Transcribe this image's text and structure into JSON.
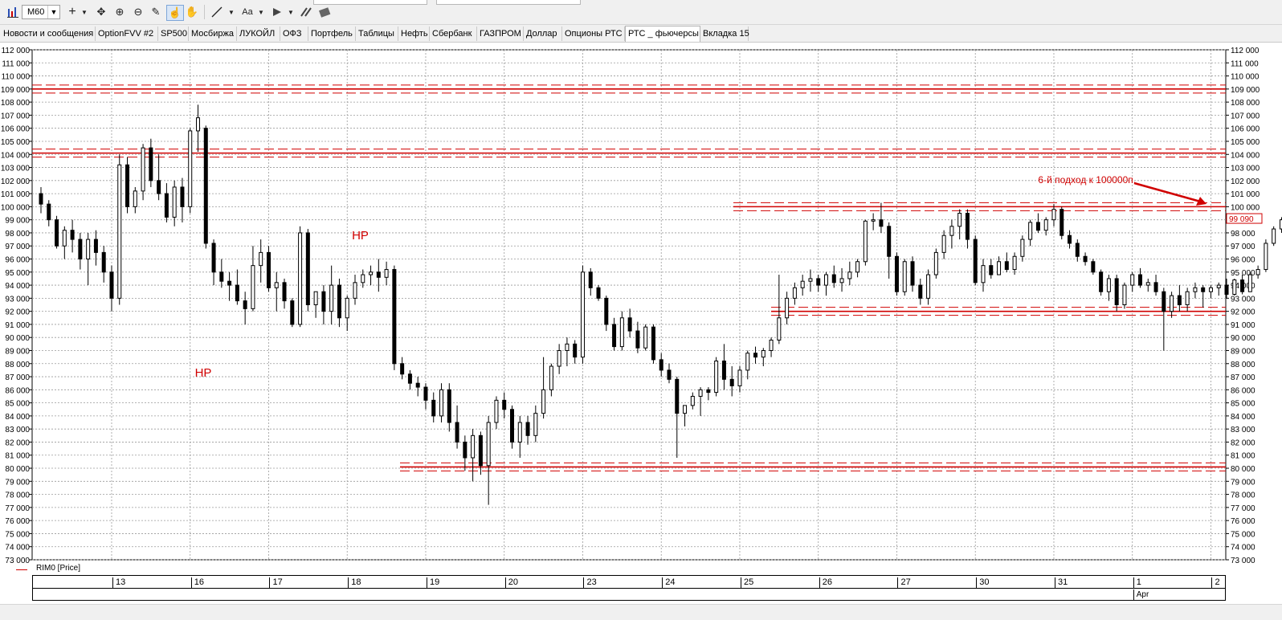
{
  "toolbar": {
    "period": "M60",
    "text_tool_label": "Aa"
  },
  "tabs": [
    "Новости и сообщения",
    "OptionFVV #2",
    "SP500",
    "Мосбиржа",
    "ЛУКОЙЛ",
    "ОФЗ",
    "Портфель",
    "Таблицы",
    "Нефть",
    "Сбербанк",
    "ГАЗПРОМ",
    "Доллар",
    "Опционы РТС",
    "РТС _ фьючерсы",
    "Вкладка 15"
  ],
  "active_tab_index": 13,
  "legend": {
    "series_label": "RIM0 [Price]"
  },
  "colors": {
    "support_lines": "#d00000",
    "annotation": "#d00000",
    "candles": "#000000",
    "price_tag": "#d00000"
  },
  "price_tag": "99 090",
  "time_axis": {
    "days": [
      "13",
      "16",
      "17",
      "18",
      "19",
      "20",
      "23",
      "24",
      "25",
      "26",
      "27",
      "30",
      "31",
      "1",
      "2"
    ],
    "month_label": "Apr"
  },
  "chart_data": {
    "type": "candlestick",
    "symbol": "RIM0",
    "timeframe": "M60",
    "ylim": [
      73000,
      112000
    ],
    "y_ticks": [
      "73 000",
      "74 000",
      "75 000",
      "76 000",
      "77 000",
      "78 000",
      "79 000",
      "80 000",
      "81 000",
      "82 000",
      "83 000",
      "84 000",
      "85 000",
      "86 000",
      "87 000",
      "88 000",
      "89 000",
      "90 000",
      "91 000",
      "92 000",
      "93 000",
      "94 000",
      "95 000",
      "96 000",
      "97 000",
      "98 000",
      "99 000",
      "100 000",
      "101 000",
      "102 000",
      "103 000",
      "104 000",
      "105 000",
      "106 000",
      "107 000",
      "108 000",
      "109 000",
      "110 000",
      "111 000",
      "112 000"
    ],
    "grid": true,
    "levels": [
      109000,
      104100,
      100000,
      92000,
      80100
    ],
    "annotations": [
      {
        "text": "НР",
        "x": 19.8,
        "y": 97500
      },
      {
        "text": "НР",
        "x": 9.8,
        "y": 87000
      },
      {
        "text": "6-й подход к 100000п.",
        "x": 63.5,
        "y": 101800
      }
    ],
    "x_start_day": "13 Mar",
    "x_day_starts": [
      5,
      10,
      15,
      20,
      25,
      30,
      35,
      40,
      45,
      50,
      55,
      60,
      65,
      70,
      75
    ],
    "candles": [
      [
        101000,
        101500,
        99500,
        100200
      ],
      [
        100200,
        100500,
        98500,
        99000
      ],
      [
        99000,
        99300,
        96800,
        97000
      ],
      [
        97000,
        98500,
        96000,
        98200
      ],
      [
        98200,
        99000,
        96500,
        97500
      ],
      [
        97500,
        98000,
        95200,
        96000
      ],
      [
        96000,
        98000,
        94000,
        97500
      ],
      [
        97500,
        98200,
        95500,
        96500
      ],
      [
        96500,
        97000,
        94200,
        95000
      ],
      [
        95000,
        95500,
        92000,
        93000
      ],
      [
        93000,
        104000,
        92500,
        103200
      ],
      [
        103200,
        103800,
        99500,
        100000
      ],
      [
        100000,
        101500,
        99500,
        101200
      ],
      [
        101200,
        104800,
        100500,
        104500
      ],
      [
        104500,
        105200,
        101500,
        102000
      ],
      [
        102000,
        104000,
        100500,
        101000
      ],
      [
        101000,
        101800,
        98800,
        99200
      ],
      [
        99200,
        102000,
        98500,
        101500
      ],
      [
        101500,
        102200,
        98800,
        100000
      ],
      [
        100000,
        106000,
        99500,
        105800
      ],
      [
        105800,
        107800,
        104200,
        106800
      ],
      [
        106000,
        106200,
        96800,
        97200
      ],
      [
        97200,
        97500,
        94000,
        95000
      ],
      [
        95000,
        96000,
        93800,
        94300
      ],
      [
        94300,
        95000,
        92800,
        94000
      ],
      [
        94000,
        95200,
        92500,
        92800
      ],
      [
        92800,
        93500,
        91000,
        92200
      ],
      [
        92200,
        97000,
        92000,
        95500
      ],
      [
        95500,
        97500,
        94200,
        96500
      ],
      [
        96500,
        97000,
        93500,
        93800
      ],
      [
        93800,
        95000,
        92000,
        94200
      ],
      [
        94200,
        94500,
        92200,
        92800
      ],
      [
        92800,
        93000,
        90800,
        91000
      ],
      [
        91000,
        98500,
        90800,
        98000
      ],
      [
        98000,
        98300,
        92000,
        92500
      ],
      [
        92500,
        93500,
        91500,
        93500
      ],
      [
        93500,
        94000,
        91000,
        92000
      ],
      [
        92000,
        95500,
        91000,
        94000
      ],
      [
        94000,
        94500,
        90800,
        91500
      ],
      [
        91500,
        93200,
        90500,
        93000
      ],
      [
        93000,
        94800,
        92500,
        94200
      ],
      [
        94200,
        95200,
        93800,
        94800
      ],
      [
        94800,
        95500,
        94000,
        95000
      ],
      [
        95000,
        96000,
        93500,
        94600
      ],
      [
        94600,
        95800,
        94000,
        95200
      ],
      [
        95200,
        95500,
        87500,
        88000
      ],
      [
        88000,
        88500,
        86800,
        87200
      ],
      [
        87200,
        87500,
        86000,
        86500
      ],
      [
        86500,
        87000,
        85500,
        86200
      ],
      [
        86200,
        86500,
        84500,
        85200
      ],
      [
        85200,
        85800,
        83500,
        84000
      ],
      [
        84000,
        86500,
        83500,
        86000
      ],
      [
        86000,
        86500,
        82800,
        83500
      ],
      [
        83500,
        84800,
        81500,
        82000
      ],
      [
        82000,
        82500,
        79800,
        80800
      ],
      [
        80800,
        83000,
        79000,
        82500
      ],
      [
        82500,
        82800,
        79500,
        80200
      ],
      [
        80200,
        84000,
        77200,
        83500
      ],
      [
        83500,
        85500,
        83000,
        85200
      ],
      [
        85200,
        85800,
        83800,
        84500
      ],
      [
        84500,
        84800,
        81500,
        82000
      ],
      [
        82000,
        84000,
        80800,
        83500
      ],
      [
        83500,
        84000,
        81800,
        82500
      ],
      [
        82500,
        84800,
        82000,
        84200
      ],
      [
        84200,
        88500,
        83800,
        86000
      ],
      [
        86000,
        88000,
        85500,
        87800
      ],
      [
        87800,
        89500,
        87200,
        89000
      ],
      [
        89000,
        90000,
        87800,
        89500
      ],
      [
        89500,
        89800,
        88000,
        88500
      ],
      [
        88500,
        95500,
        88000,
        95000
      ],
      [
        95000,
        95300,
        93200,
        93800
      ],
      [
        93800,
        94000,
        92800,
        93000
      ],
      [
        93000,
        93200,
        90500,
        91000
      ],
      [
        91000,
        91500,
        89000,
        89300
      ],
      [
        89300,
        92000,
        89000,
        91500
      ],
      [
        91500,
        92200,
        90000,
        90500
      ],
      [
        90500,
        91200,
        88800,
        89200
      ],
      [
        89200,
        91000,
        89000,
        90800
      ],
      [
        90800,
        91000,
        88000,
        88300
      ],
      [
        88300,
        88800,
        87000,
        87500
      ],
      [
        87500,
        88000,
        86500,
        86800
      ],
      [
        86800,
        87000,
        80800,
        84200
      ],
      [
        84200,
        84800,
        83200,
        84800
      ],
      [
        84800,
        85800,
        84500,
        85500
      ],
      [
        85500,
        86200,
        84000,
        86000
      ],
      [
        86000,
        86200,
        85200,
        85800
      ],
      [
        85800,
        88500,
        85500,
        88200
      ],
      [
        88200,
        89500,
        86000,
        86800
      ],
      [
        86800,
        87800,
        85500,
        86300
      ],
      [
        86300,
        87800,
        85800,
        87500
      ],
      [
        87500,
        89000,
        86800,
        88800
      ],
      [
        88800,
        89300,
        88000,
        88500
      ],
      [
        88500,
        89200,
        87800,
        89000
      ],
      [
        89000,
        90000,
        88500,
        89800
      ],
      [
        89800,
        94800,
        89500,
        91500
      ],
      [
        91500,
        93500,
        91000,
        93000
      ],
      [
        93000,
        94200,
        92500,
        93800
      ],
      [
        93800,
        94800,
        93200,
        94300
      ],
      [
        94300,
        95200,
        93500,
        94500
      ],
      [
        94500,
        94800,
        93500,
        94000
      ],
      [
        94000,
        95000,
        93200,
        94800
      ],
      [
        94800,
        95500,
        93800,
        94200
      ],
      [
        94200,
        95300,
        93500,
        94500
      ],
      [
        94500,
        95800,
        94000,
        95000
      ],
      [
        95000,
        96000,
        94600,
        95800
      ],
      [
        95800,
        99000,
        95500,
        98900
      ],
      [
        98900,
        99500,
        98200,
        99000
      ],
      [
        99000,
        100300,
        98000,
        98500
      ],
      [
        98500,
        98800,
        94500,
        96200
      ],
      [
        96200,
        96500,
        93200,
        93500
      ],
      [
        93500,
        96000,
        93200,
        95800
      ],
      [
        95800,
        96200,
        93500,
        94000
      ],
      [
        94000,
        94500,
        92500,
        93000
      ],
      [
        93000,
        95200,
        92500,
        94800
      ],
      [
        94800,
        96800,
        94500,
        96500
      ],
      [
        96500,
        98200,
        96000,
        97800
      ],
      [
        97800,
        99000,
        96800,
        98500
      ],
      [
        98500,
        99800,
        97500,
        99500
      ],
      [
        99500,
        99800,
        96800,
        97500
      ],
      [
        97500,
        97800,
        94000,
        94200
      ],
      [
        94200,
        96000,
        93500,
        95500
      ],
      [
        95500,
        96000,
        94500,
        94800
      ],
      [
        94800,
        96200,
        94800,
        95800
      ],
      [
        95800,
        96500,
        95000,
        95200
      ],
      [
        95200,
        96500,
        94800,
        96200
      ],
      [
        96200,
        97800,
        95800,
        97500
      ],
      [
        97500,
        99000,
        97000,
        98800
      ],
      [
        98800,
        99500,
        98000,
        98200
      ],
      [
        98200,
        99200,
        97800,
        99000
      ],
      [
        99000,
        100200,
        98500,
        99800
      ],
      [
        99800,
        100000,
        97500,
        97800
      ],
      [
        97800,
        98200,
        96800,
        97200
      ],
      [
        97200,
        97500,
        95800,
        96200
      ],
      [
        96200,
        96500,
        95500,
        95800
      ],
      [
        95800,
        96000,
        94800,
        95000
      ],
      [
        95000,
        95200,
        93200,
        93500
      ],
      [
        93500,
        94800,
        92800,
        94500
      ],
      [
        94500,
        94800,
        92000,
        92500
      ],
      [
        92500,
        94200,
        92200,
        94000
      ],
      [
        94000,
        95000,
        93500,
        94800
      ],
      [
        94800,
        95300,
        93800,
        94000
      ],
      [
        94000,
        94500,
        93500,
        94200
      ],
      [
        94200,
        94800,
        93200,
        93500
      ],
      [
        93500,
        93800,
        89000,
        92000
      ],
      [
        92000,
        93500,
        91500,
        93200
      ],
      [
        93200,
        94000,
        92000,
        92500
      ],
      [
        92500,
        93800,
        92000,
        93500
      ],
      [
        93500,
        94200,
        93000,
        93800
      ],
      [
        93800,
        94000,
        92300,
        93500
      ],
      [
        93500,
        94000,
        93000,
        93800
      ],
      [
        93800,
        94200,
        93200,
        94000
      ],
      [
        94000,
        94500,
        93000,
        93300
      ],
      [
        93300,
        94500,
        93200,
        94400
      ],
      [
        94400,
        94800,
        93300,
        93500
      ],
      [
        93500,
        95000,
        93500,
        94800
      ],
      [
        94800,
        95500,
        94500,
        95200
      ],
      [
        95200,
        97500,
        95000,
        97200
      ],
      [
        97200,
        98500,
        97000,
        98300
      ],
      [
        98300,
        99200,
        98000,
        99000
      ],
      [
        99000,
        99200,
        97800,
        98200
      ],
      [
        98200,
        98500,
        96800,
        97200
      ],
      [
        97200,
        97500,
        96200,
        96500
      ],
      [
        96500,
        97800,
        96200,
        97500
      ],
      [
        97500,
        99000,
        97200,
        98800
      ],
      [
        98800,
        99000,
        97500,
        97800
      ],
      [
        97800,
        98000,
        96800,
        97200
      ],
      [
        97200,
        97500,
        96900,
        97200
      ],
      [
        97200,
        97500,
        96800,
        97000
      ],
      [
        97000,
        97200,
        93800,
        96500
      ],
      [
        96500,
        97000,
        96000,
        96800
      ],
      [
        96800,
        97300,
        96500,
        97000
      ],
      [
        97000,
        97200,
        96500,
        96900
      ],
      [
        96900,
        97400,
        96600,
        97100
      ],
      [
        97100,
        97300,
        96500,
        96800
      ],
      [
        96800,
        97200,
        96400,
        97000
      ],
      [
        97000,
        97400,
        96700,
        97200
      ],
      [
        97200,
        97300,
        96600,
        96800
      ],
      [
        96800,
        97000,
        95800,
        96200
      ],
      [
        96200,
        96400,
        95000,
        95500
      ],
      [
        95500,
        96300,
        95200,
        96000
      ],
      [
        96000,
        96200,
        95000,
        95300
      ],
      [
        95300,
        96500,
        95000,
        96400
      ],
      [
        96400,
        102500,
        96200,
        99300
      ],
      [
        99300,
        99700,
        98700,
        99100
      ],
      [
        99100,
        99500,
        98800,
        99100
      ]
    ]
  }
}
